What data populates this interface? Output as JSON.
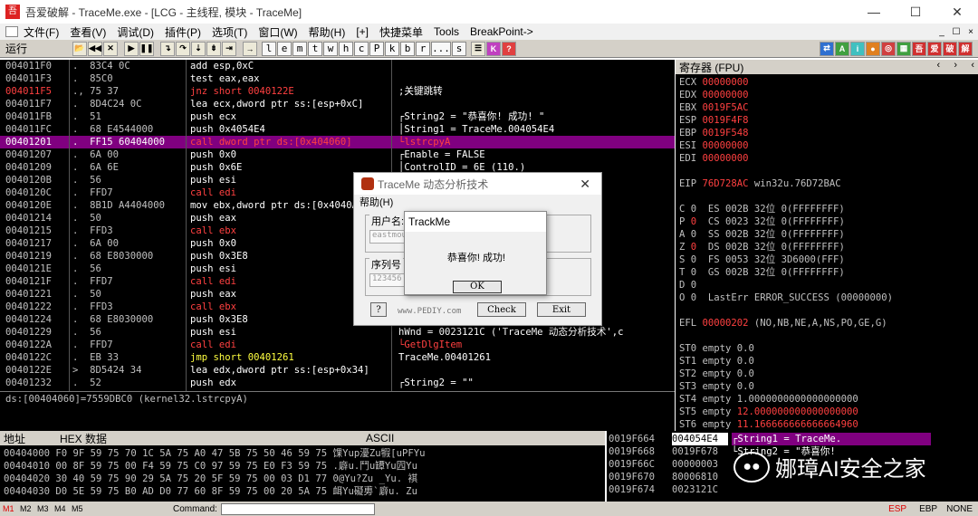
{
  "window": {
    "title": "吾爱破解 - TraceMe.exe - [LCG - 主线程, 模块 - TraceMe]",
    "min": "—",
    "max": "☐",
    "close": "✕",
    "app_icon": "吾"
  },
  "menu": [
    "文件(F)",
    "查看(V)",
    "调试(D)",
    "插件(P)",
    "选项(T)",
    "窗口(W)",
    "帮助(H)",
    "[+]",
    "快捷菜单",
    "Tools",
    "BreakPoint->"
  ],
  "menu_right": [
    "_",
    "☐",
    "×"
  ],
  "toolbar": {
    "status": "运行",
    "letters": [
      "l",
      "e",
      "m",
      "t",
      "w",
      "h",
      "c",
      "P",
      "k",
      "b",
      "r",
      "...",
      "s"
    ]
  },
  "cpu_rows": [
    {
      "a": "004011F0",
      "h": ".  83C4 0C",
      "d": "add esp,0xC",
      "dc": "",
      "c": "",
      "cc": ""
    },
    {
      "a": "004011F3",
      "h": ".  85C0",
      "d": "test eax,eax",
      "dc": "",
      "c": "",
      "cc": ""
    },
    {
      "a": "004011F5",
      "h": "., 75 37",
      "d": "jnz short 0040122E",
      "dc": "red",
      "c": ";关键跳转",
      "cc": "",
      "ac": "red"
    },
    {
      "a": "004011F7",
      "h": ".  8D4C24 0C",
      "d": "lea ecx,dword ptr ss:[esp+0xC]",
      "dc": "",
      "c": "",
      "cc": ""
    },
    {
      "a": "004011FB",
      "h": ".  51",
      "d": "push ecx",
      "dc": "",
      "c": "┌String2 = \"恭喜你! 成功! \"",
      "cc": ""
    },
    {
      "a": "004011FC",
      "h": ".  68 E4544000",
      "d": "push 0x4054E4",
      "dc": "",
      "c": "│String1 = TraceMe.004054E4",
      "cc": ""
    },
    {
      "a": "00401201",
      "h": ".  FF15 60404000",
      "d": "call dword ptr ds:[0x404060]",
      "dc": "red",
      "c": "└lstrcpyA",
      "cc": "red",
      "sel": true
    },
    {
      "a": "00401207",
      "h": ".  6A 00",
      "d": "push 0x0",
      "dc": "",
      "c": "┌Enable = FALSE",
      "cc": ""
    },
    {
      "a": "00401209",
      "h": ".  6A 6E",
      "d": "push 0x6E",
      "dc": "",
      "c": "│ControlID = 6E (110.)",
      "cc": ""
    },
    {
      "a": "0040120B",
      "h": ".  56",
      "d": "push esi",
      "dc": "",
      "c": "",
      "cc": ""
    },
    {
      "a": "0040120C",
      "h": ".  FFD7",
      "d": "call edi",
      "dc": "red",
      "c": "",
      "cc": ""
    },
    {
      "a": "0040120E",
      "h": ".  8B1D A4404000",
      "d": "mov ebx,dword ptr ds:[0x4040A4]",
      "dc": "",
      "c": "",
      "cc": ""
    },
    {
      "a": "00401214",
      "h": ".  50",
      "d": "push eax",
      "dc": "",
      "c": "",
      "cc": ""
    },
    {
      "a": "00401215",
      "h": ".  FFD3",
      "d": "call ebx",
      "dc": "red",
      "c": "",
      "cc": ""
    },
    {
      "a": "00401217",
      "h": ".  6A 00",
      "d": "push 0x0",
      "dc": "",
      "c": "",
      "cc": ""
    },
    {
      "a": "00401219",
      "h": ".  68 E8030000",
      "d": "push 0x3E8",
      "dc": "",
      "c": "",
      "cc": ""
    },
    {
      "a": "0040121E",
      "h": ".  56",
      "d": "push esi",
      "dc": "",
      "c": "",
      "cc": ""
    },
    {
      "a": "0040121F",
      "h": ".  FFD7",
      "d": "call edi",
      "dc": "red",
      "c": "",
      "cc": ""
    },
    {
      "a": "00401221",
      "h": ".  50",
      "d": "push eax",
      "dc": "",
      "c": "",
      "cc": ""
    },
    {
      "a": "00401222",
      "h": ".  FFD3",
      "d": "call ebx",
      "dc": "red",
      "c": "",
      "cc": ""
    },
    {
      "a": "00401224",
      "h": ".  68 E8030000",
      "d": "push 0x3E8",
      "dc": "",
      "c": "",
      "cc": ""
    },
    {
      "a": "00401229",
      "h": ".  56",
      "d": "push esi",
      "dc": "",
      "c": "hWnd = 0023121C ('TraceMe 动态分析技术',c",
      "cc": ""
    },
    {
      "a": "0040122A",
      "h": ".  FFD7",
      "d": "call edi",
      "dc": "red",
      "c": "└GetDlgItem",
      "cc": "red"
    },
    {
      "a": "0040122C",
      "h": ".  EB 33",
      "d": "jmp short 00401261",
      "dc": "yel",
      "c": "TraceMe.00401261",
      "cc": ""
    },
    {
      "a": "0040122E",
      "h": ">  8D5424 34",
      "d": "lea edx,dword ptr ss:[esp+0x34]",
      "dc": "",
      "c": "",
      "cc": ""
    },
    {
      "a": "00401232",
      "h": ".  52",
      "d": "push edx",
      "dc": "",
      "c": "┌String2 = \"\"",
      "cc": ""
    }
  ],
  "info_line": "ds:[00404060]=7559DBC0 (kernel32.lstrcpyA)",
  "regs": {
    "header": "寄存器 (FPU)",
    "lines": [
      {
        "t": "ECX ",
        "v": "00000000",
        "w": ""
      },
      {
        "t": "EDX ",
        "v": "00000000",
        "w": ""
      },
      {
        "t": "EBX ",
        "v": "0019F5AC",
        "w": ""
      },
      {
        "t": "ESP ",
        "v": "0019F4F8",
        "w": ""
      },
      {
        "t": "EBP ",
        "v": "0019F548",
        "w": ""
      },
      {
        "t": "ESI ",
        "v": "00000000",
        "w": ""
      },
      {
        "t": "EDI ",
        "v": "00000000",
        "w": ""
      },
      {
        "t": "",
        "v": "",
        "w": ""
      },
      {
        "t": "EIP ",
        "v": "76D728AC",
        "w": " win32u.76D72BAC"
      },
      {
        "t": "",
        "v": "",
        "w": ""
      },
      {
        "t": "C 0  ES 002B 32位 0(FFFFFFFF)",
        "v": "",
        "w": ""
      },
      {
        "t": "P ",
        "v": "0",
        "w": "  CS 0023 32位 0(FFFFFFFF)"
      },
      {
        "t": "A 0  SS 002B 32位 0(FFFFFFFF)",
        "v": "",
        "w": ""
      },
      {
        "t": "Z ",
        "v": "0",
        "w": "  DS 002B 32位 0(FFFFFFFF)"
      },
      {
        "t": "S 0  FS 0053 32位 3D6000(FFF)",
        "v": "",
        "w": ""
      },
      {
        "t": "T 0  GS 002B 32位 0(FFFFFFFF)",
        "v": "",
        "w": ""
      },
      {
        "t": "D 0",
        "v": "",
        "w": ""
      },
      {
        "t": "O 0  LastErr ERROR_SUCCESS (00000000)",
        "v": "",
        "w": ""
      },
      {
        "t": "",
        "v": "",
        "w": ""
      },
      {
        "t": "EFL ",
        "v": "00000202",
        "w": " (NO,NB,NE,A,NS,PO,GE,G)"
      },
      {
        "t": "",
        "v": "",
        "w": ""
      },
      {
        "t": "ST0 empty 0.0",
        "v": "",
        "w": ""
      },
      {
        "t": "ST1 empty 0.0",
        "v": "",
        "w": ""
      },
      {
        "t": "ST2 empty 0.0",
        "v": "",
        "w": ""
      },
      {
        "t": "ST3 empty 0.0",
        "v": "",
        "w": ""
      },
      {
        "t": "ST4 empty 1.0000000000000000000",
        "v": "",
        "w": ""
      },
      {
        "t": "ST5 empty ",
        "v": "12.000000000000000000",
        "w": ""
      },
      {
        "t": "ST6 empty ",
        "v": "11.166666666666664960",
        "w": ""
      },
      {
        "t": "ST7 empty 0.0",
        "v": "",
        "w": ""
      },
      {
        "t": "               3 2 1 0      E S P U O Z D I",
        "v": "",
        "w": ""
      }
    ]
  },
  "dump": {
    "headers": [
      "地址",
      "HEX 数据",
      "ASCII"
    ],
    "rows": [
      "00404000 F0 9F 59 75 70 1C 5A 75 A0 47 5B 75 50 46 59 75 馃Yup瀀Zu犌[uPFYu",
      "00404010 00 8F 59 75 00 F4 59 75 C0 97 59 75 E0 F3 59 75 .廦u.鬥u罈Yu囥Yu",
      "00404020 30 40 59 75 90 29 5A 75 20 5F 59 75 00 03 D1 77 0@Yu?Zu _Yu. 褀",
      "00404030 D0 5E 59 75 B0 AD D0 77 60 8F 59 75 00 20 5A 75 衈Yu礙旉`廦u. Zu"
    ]
  },
  "stack": {
    "rows": [
      {
        "a": "0019F664",
        "v": "004054E4",
        "c": "┌String1 = TraceMe.",
        "sel": true
      },
      {
        "a": "0019F668",
        "v": "0019F678",
        "c": "└String2 = \"恭喜你!",
        "sel": false
      },
      {
        "a": "0019F66C",
        "v": "00000003",
        "c": "",
        "sel": false
      },
      {
        "a": "0019F670",
        "v": "80006810",
        "c": "",
        "sel": false
      },
      {
        "a": "0019F674",
        "v": "0023121C",
        "c": "",
        "sel": false
      }
    ]
  },
  "cmd": {
    "modes": [
      "M1",
      "M2",
      "M3",
      "M4",
      "M5"
    ],
    "label": "Command:",
    "right": [
      "ESP",
      "EBP",
      "NONE"
    ]
  },
  "dialog": {
    "title": "TraceMe 动态分析技术",
    "menu": "帮助(H)",
    "user_label": "用户名:",
    "user_value": "eastmou",
    "serial_label": "序列号",
    "serial_value": "123456",
    "help_btn": "?",
    "site": "www.PEDIY.com",
    "check": "Check",
    "exit": "Exit"
  },
  "msgbox": {
    "title": "TrackMe",
    "message": "恭喜你! 成功!",
    "ok": "OK"
  },
  "watermark": "娜璋AI安全之家",
  "colors": {
    "bg": "#000000",
    "text": "#c0c0c0",
    "red": "#ff4040",
    "sel": "#800080"
  }
}
